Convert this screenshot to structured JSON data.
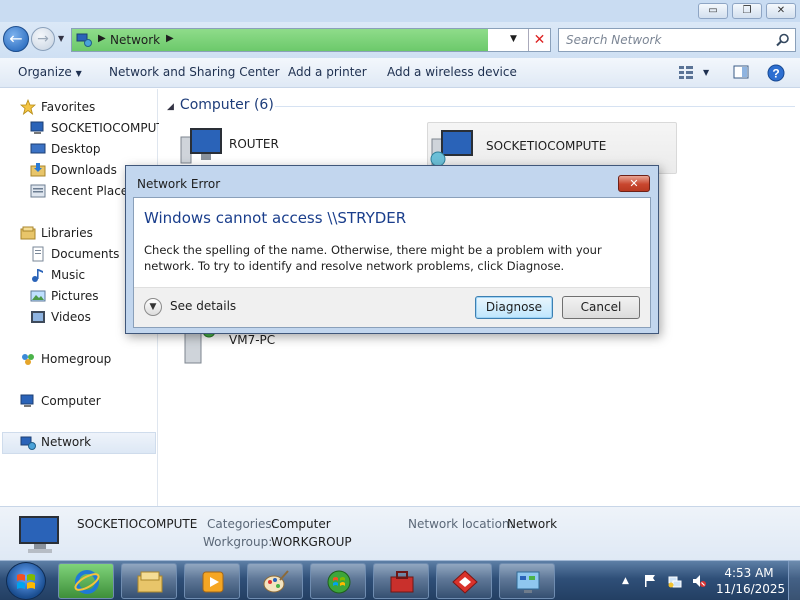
{
  "window": {
    "controls": [
      "minimize",
      "restore",
      "close"
    ]
  },
  "address_bar": {
    "segments": [
      "Network"
    ],
    "progress_fraction": 0.87
  },
  "search": {
    "placeholder": "Search Network"
  },
  "commands": [
    "Organize",
    "Network and Sharing Center",
    "Add a printer",
    "Add a wireless device"
  ],
  "nav": {
    "favorites": {
      "label": "Favorites",
      "items": [
        "SOCKETIOCOMPUT",
        "Desktop",
        "Downloads",
        "Recent Places"
      ]
    },
    "libraries": {
      "label": "Libraries",
      "items": [
        "Documents",
        "Music",
        "Pictures",
        "Videos"
      ]
    },
    "homegroup": "Homegroup",
    "computer": "Computer",
    "network": "Network"
  },
  "content": {
    "group_header": "Computer (6)",
    "items": [
      "ROUTER",
      "SOCKETIOCOMPUTE",
      "VM7-PC"
    ]
  },
  "details": {
    "name": "SOCKETIOCOMPUTE",
    "categories_label": "Categories:",
    "categories_value": "Computer",
    "workgroup_label": "Workgroup:",
    "workgroup_value": "WORKGROUP",
    "location_label": "Network location:",
    "location_value": "Network"
  },
  "dialog": {
    "title": "Network Error",
    "close_glyph": "✕",
    "heading": "Windows cannot access \\\\STRYDER",
    "message": "Check the spelling of the name. Otherwise, there might be a problem with your network. To try to identify and resolve network problems, click Diagnose.",
    "see_details": "See details",
    "diagnose": "Diagnose",
    "cancel": "Cancel"
  },
  "taskbar": {
    "time": "4:53 AM",
    "date": "11/16/2025",
    "apps": [
      "internet-explorer",
      "windows-explorer",
      "media-player",
      "paint",
      "media-center",
      "toolbox",
      "parallels",
      "control-panel"
    ]
  },
  "colors": {
    "heading_blue": "#1a3e8c",
    "group_blue": "#1e3d7a",
    "address_progress": "#6cc96b"
  }
}
